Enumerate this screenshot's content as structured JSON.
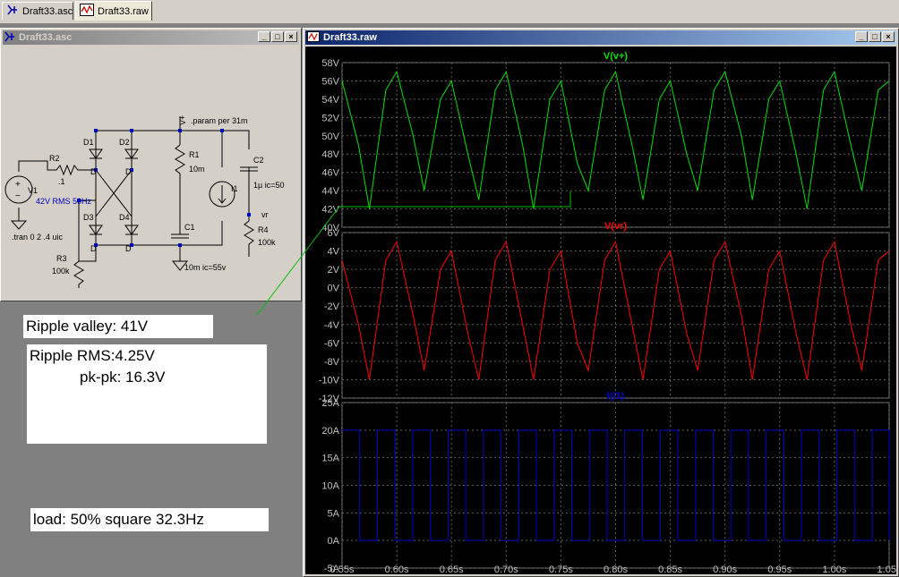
{
  "tabs": [
    {
      "label": "Draft33.asc",
      "icon": "schematic-icon"
    },
    {
      "label": "Draft33.raw",
      "icon": "waveform-icon"
    }
  ],
  "schematic_window": {
    "title": "Draft33.asc"
  },
  "waveform_window": {
    "title": "Draft33.raw"
  },
  "schematic": {
    "labels": {
      "d1": "D1",
      "d2": "D2",
      "d3": "D3",
      "d4": "D4",
      "r1": "R1",
      "r1v": "10m",
      "r2": "R2",
      "r2v": ".1",
      "r3": "R3",
      "r3v": "100k",
      "r4": "R4",
      "r4v": "100k",
      "c1": "C1",
      "c1v": "10m ic=55v",
      "c2": "C2",
      "c2v": "1µ ic=50",
      "i1": "I1",
      "v1": "V1",
      "v1v": "42V RMS 50Hz",
      "tran": ".tran 0 2 .4 uic",
      "param": ".param per 31m",
      "vplus": "V+",
      "vr": "vr",
      "dd1": "D",
      "dd2": "D",
      "dd3": "D",
      "dd4": "D"
    }
  },
  "annotations": {
    "ripple_valley": "Ripple valley: 41V",
    "ripple_rms_label": "Ripple RMS:",
    "ripple_rms_value": "4.25V",
    "pkpk_label": "pk-pk:",
    "pkpk_value": "16.3V",
    "load": "load: 50% square 32.3Hz"
  },
  "chart_data": [
    {
      "type": "line",
      "title": "V(v+)",
      "color": "#00e000",
      "ylim": [
        40,
        58
      ],
      "ytick_labels": [
        "58V",
        "56V",
        "54V",
        "52V",
        "50V",
        "48V",
        "46V",
        "44V",
        "42V",
        "40V"
      ],
      "x": [
        0.55,
        0.565,
        0.575,
        0.59,
        0.6,
        0.615,
        0.625,
        0.64,
        0.65,
        0.665,
        0.675,
        0.69,
        0.7,
        0.715,
        0.725,
        0.74,
        0.75,
        0.765,
        0.775,
        0.79,
        0.8,
        0.815,
        0.825,
        0.84,
        0.85,
        0.865,
        0.875,
        0.89,
        0.9,
        0.915,
        0.925,
        0.94,
        0.95,
        0.965,
        0.975,
        0.99,
        1.0,
        1.015,
        1.025,
        1.04,
        1.05
      ],
      "values": [
        56,
        49,
        42,
        55,
        57,
        50,
        44,
        54,
        56,
        48,
        43,
        55,
        57,
        49,
        42,
        54,
        56,
        47,
        44,
        55,
        57,
        49,
        43,
        54,
        56,
        48,
        44,
        55,
        57,
        50,
        43,
        54,
        56,
        48,
        42,
        55,
        57,
        49,
        44,
        55,
        56
      ]
    },
    {
      "type": "line",
      "title": "V(vr)",
      "color": "#ff0000",
      "ylim": [
        -12,
        6
      ],
      "ytick_labels": [
        "6V",
        "4V",
        "2V",
        "0V",
        "-2V",
        "-4V",
        "-6V",
        "-8V",
        "-10V",
        "-12V"
      ],
      "x": [
        0.55,
        0.565,
        0.575,
        0.59,
        0.6,
        0.615,
        0.625,
        0.64,
        0.65,
        0.665,
        0.675,
        0.69,
        0.7,
        0.715,
        0.725,
        0.74,
        0.75,
        0.765,
        0.775,
        0.79,
        0.8,
        0.815,
        0.825,
        0.84,
        0.85,
        0.865,
        0.875,
        0.89,
        0.9,
        0.915,
        0.925,
        0.94,
        0.95,
        0.965,
        0.975,
        0.99,
        1.0,
        1.015,
        1.025,
        1.04,
        1.05
      ],
      "values": [
        3,
        -4,
        -10,
        3,
        5,
        -3,
        -9,
        2,
        4,
        -5,
        -10,
        3,
        5,
        -4,
        -10,
        2,
        4,
        -6,
        -9,
        3,
        5,
        -4,
        -10,
        2,
        4,
        -5,
        -9,
        3,
        5,
        -3,
        -10,
        2,
        4,
        -5,
        -10,
        3,
        5,
        -4,
        -9,
        3,
        4
      ]
    },
    {
      "type": "line",
      "title": "I(I1)",
      "color": "#0000c8",
      "ylim": [
        -5,
        25
      ],
      "ytick_labels": [
        "25A",
        "20A",
        "15A",
        "10A",
        "5A",
        "0A",
        "-5A"
      ],
      "square": {
        "period": 0.0323,
        "high": 20,
        "low": 0,
        "start": 0.55,
        "end": 1.05
      }
    }
  ],
  "x_tick_labels": [
    "0.55s",
    "0.60s",
    "0.65s",
    "0.70s",
    "0.75s",
    "0.80s",
    "0.85s",
    "0.90s",
    "0.95s",
    "1.00s",
    "1.05s"
  ]
}
